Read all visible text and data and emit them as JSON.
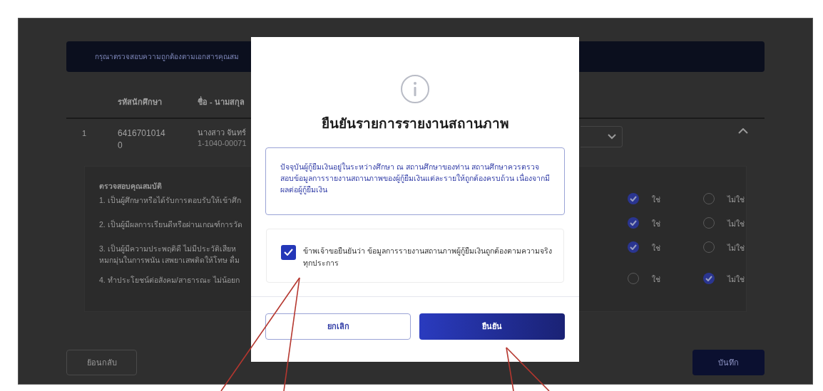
{
  "background_page": {
    "banner": "กรุณาตรวจสอบความถูกต้องตามเอกสารคุณสม",
    "table": {
      "columns": [
        "รหัสนักศึกษา",
        "ชื่อ - นามสกุล"
      ],
      "row": {
        "number": "1",
        "student_id": "6416701014 0",
        "name": "นางสาว จันทร์",
        "sub_id": "1-1040-00071"
      },
      "expanded": true,
      "checklist_title": "ตรวจสอบคุณสมบัติ",
      "checklist": [
        {
          "text": "1. เป็นผู้ศึกษาหรือได้รับการตอบรับให้เข้าศึก",
          "options": [
            {
              "label": "ใช่",
              "selected": true
            },
            {
              "label": "ไม่ใช่",
              "selected": false
            }
          ]
        },
        {
          "text": "2. เป็นผู้มีผลการเรียนดีหรือผ่านเกณฑ์การวัด",
          "options": [
            {
              "label": "ใช่",
              "selected": true
            },
            {
              "label": "ไม่ใช่",
              "selected": false
            }
          ]
        },
        {
          "text": "3. เป็นผู้มีความประพฤติดี ไม่มีประวัติเสียห",
          "text_2": "หมกมุ่นในการพนัน เสพยาเสพติดให้โทษ ดื่ม",
          "options": [
            {
              "label": "ใช่",
              "selected": true
            },
            {
              "label": "ไม่ใช่",
              "selected": false
            }
          ]
        },
        {
          "text": "4. ทำประโยชน์ต่อสังคม/สาธารณะ ไม่น้อยก",
          "options": [
            {
              "label": "ใช่",
              "selected": false
            },
            {
              "label": "ไม่ใช่",
              "selected": true
            }
          ]
        }
      ]
    },
    "back_button": "ย้อนกลับ",
    "save_button": "บันทึก"
  },
  "dialog": {
    "title": "ยืนยันรายการรายงานสถานภาพ",
    "notice": "ปัจจุบันผู้กู้ยืมเงินอยู่ในระหว่างศึกษา ณ สถานศึกษาของท่าน สถานศึกษาควรตรวจสอบข้อมูลการรายงานสถานภาพของผู้กู้ยืมเงินแต่ละรายให้ถูกต้องครบถ้วน เนื่องจากมีผลต่อผู้กู้ยืมเงิน",
    "confirmation": {
      "label": "ข้าพเจ้าขอยืนยันว่า ข้อมูลการรายงานสถานภาพผู้กู้ยืมเงินถูกต้องตามความจริงทุกประการ",
      "checked": true
    },
    "buttons": [
      {
        "label": "ยกเลิก",
        "kind": "secondary"
      },
      {
        "label": "ยืนยัน",
        "kind": "primary"
      }
    ]
  }
}
